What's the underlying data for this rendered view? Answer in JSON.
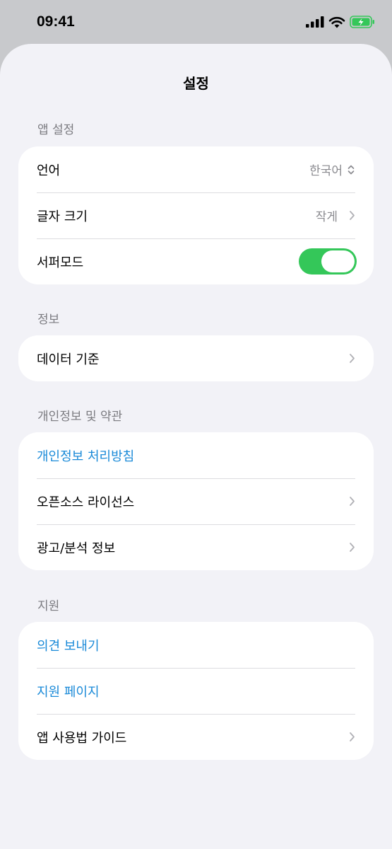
{
  "status_bar": {
    "time": "09:41",
    "icons": [
      "cellular-signal-icon",
      "wifi-icon",
      "battery-charging-icon"
    ],
    "battery_color": "#34c759"
  },
  "sheet": {
    "title": "설정"
  },
  "sections": {
    "app_settings": {
      "header": "앱 설정",
      "language": {
        "label": "언어",
        "value": "한국어",
        "icon": "chevron-up-down-icon"
      },
      "font_size": {
        "label": "글자 크기",
        "value": "작게",
        "icon": "chevron-right-icon"
      },
      "surfer_mode": {
        "label": "서퍼모드",
        "toggle_on": true,
        "toggle_color": "#34c759"
      }
    },
    "info": {
      "header": "정보",
      "data_source": {
        "label": "데이터 기준",
        "icon": "chevron-right-icon"
      }
    },
    "privacy": {
      "header": "개인정보 및 약관",
      "privacy_policy": {
        "label": "개인정보 처리방침",
        "color": "#1a8ad8"
      },
      "open_source": {
        "label": "오픈소스 라이선스",
        "icon": "chevron-right-icon"
      },
      "ads_analytics": {
        "label": "광고/분석 정보",
        "icon": "chevron-right-icon"
      }
    },
    "support": {
      "header": "지원",
      "send_feedback": {
        "label": "의견 보내기",
        "color": "#1a8ad8"
      },
      "support_page": {
        "label": "지원 페이지",
        "color": "#1a8ad8"
      },
      "user_guide": {
        "label": "앱 사용법 가이드",
        "icon": "chevron-right-icon"
      }
    }
  }
}
